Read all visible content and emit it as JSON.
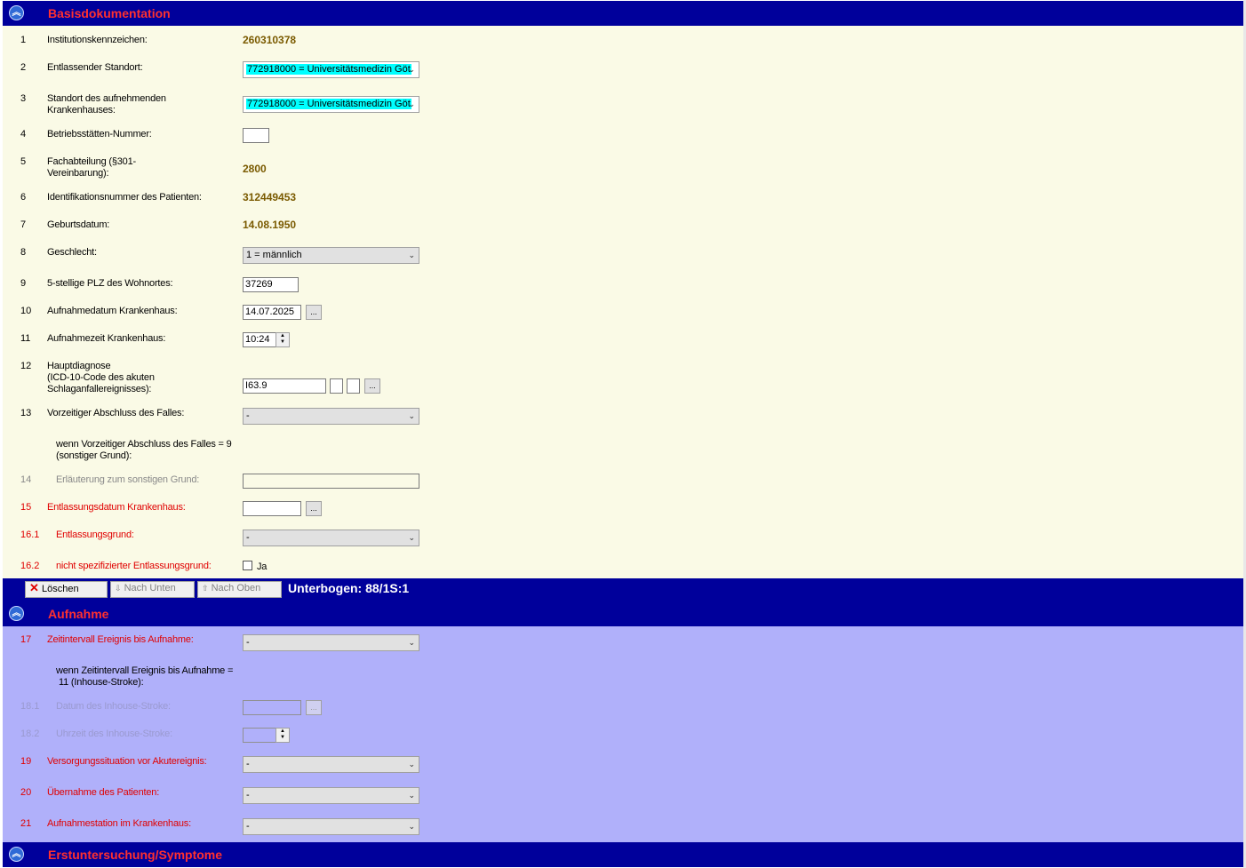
{
  "basis": {
    "title": "Basisdokumentation",
    "rows": {
      "r1": {
        "num": "1",
        "label": "Institutionskennzeichen:",
        "value": "260310378"
      },
      "r2": {
        "num": "2",
        "label": "Entlassender Standort:",
        "value": "772918000 = Universitätsmedizin Göt"
      },
      "r3": {
        "num": "3",
        "label": "Standort des aufnehmenden Krankenhauses:",
        "value": "772918000 = Universitätsmedizin Göt"
      },
      "r4": {
        "num": "4",
        "label": "Betriebsstätten-Nummer:",
        "value": ""
      },
      "r5": {
        "num": "5",
        "label": "Fachabteilung (§301-Vereinbarung):",
        "value": "2800"
      },
      "r6": {
        "num": "6",
        "label": "Identifikationsnummer des Patienten:",
        "value": "312449453"
      },
      "r7": {
        "num": "7",
        "label": "Geburtsdatum:",
        "value": "14.08.1950"
      },
      "r8": {
        "num": "8",
        "label": "Geschlecht:",
        "value": "1 = männlich"
      },
      "r9": {
        "num": "9",
        "label": "5-stellige PLZ des Wohnortes:",
        "value": "37269"
      },
      "r10": {
        "num": "10",
        "label": "Aufnahmedatum Krankenhaus:",
        "value": "14.07.2025",
        "button": "..."
      },
      "r11": {
        "num": "11",
        "label": "Aufnahmezeit Krankenhaus:",
        "value": "10:24"
      },
      "r12": {
        "num": "12",
        "label_line1": "Hauptdiagnose",
        "label_line2": "(ICD-10-Code des akuten",
        "label_line3": "Schlaganfallereignisses):",
        "value": "I63.9",
        "button": "..."
      },
      "r13": {
        "num": "13",
        "label": "Vorzeitiger Abschluss des Falles:",
        "value": "-"
      },
      "r13note": {
        "line1": "wenn Vorzeitiger Abschluss des Falles =  9",
        "line2": "(sonstiger Grund):"
      },
      "r14": {
        "num": "14",
        "label": "Erläuterung zum sonstigen Grund:",
        "value": ""
      },
      "r15": {
        "num": "15",
        "label": "Entlassungsdatum Krankenhaus:",
        "value": "",
        "button": "..."
      },
      "r161": {
        "num": "16.1",
        "label": "Entlassungsgrund:",
        "value": "-"
      },
      "r162": {
        "num": "16.2",
        "label": "nicht spezifizierter Entlassungsgrund:",
        "check_label": "Ja"
      }
    }
  },
  "toolbar": {
    "delete_label": "Löschen",
    "down_label": "Nach Unten",
    "up_label": "Nach Oben",
    "subform_info": "Unterbogen: 88/1S:1"
  },
  "aufnahme": {
    "title": "Aufnahme",
    "rows": {
      "r17": {
        "num": "17",
        "label": "Zeitintervall Ereignis bis Aufnahme:",
        "value": "-"
      },
      "r17note": {
        "line1": "wenn Zeitintervall Ereignis bis Aufnahme =",
        "line2": "11 (Inhouse-Stroke):"
      },
      "r181": {
        "num": "18.1",
        "label": "Datum des Inhouse-Stroke:",
        "value": "",
        "button": "..."
      },
      "r182": {
        "num": "18.2",
        "label": "Uhrzeit des Inhouse-Stroke:",
        "value": ""
      },
      "r19": {
        "num": "19",
        "label": "Versorgungssituation vor Akutereignis:",
        "value": "-"
      },
      "r20": {
        "num": "20",
        "label": "Übernahme des Patienten:",
        "value": "-"
      },
      "r21": {
        "num": "21",
        "label": "Aufnahmestation im Krankenhaus:",
        "value": "-"
      }
    }
  },
  "erst": {
    "title": "Erstuntersuchung/Symptome"
  },
  "icons": {
    "collapse": "double-chevron-up-icon",
    "delete": "red-x-icon",
    "down": "arrow-down-icon",
    "up": "arrow-up-icon",
    "dropdown": "chevron-down-icon"
  },
  "colors": {
    "header_bg": "#00009b",
    "header_text": "#ff3030",
    "panel_yellow": "#fafae6",
    "panel_blue": "#b0b0fa",
    "highlight": "#00ffff",
    "required_label": "#e00000"
  }
}
